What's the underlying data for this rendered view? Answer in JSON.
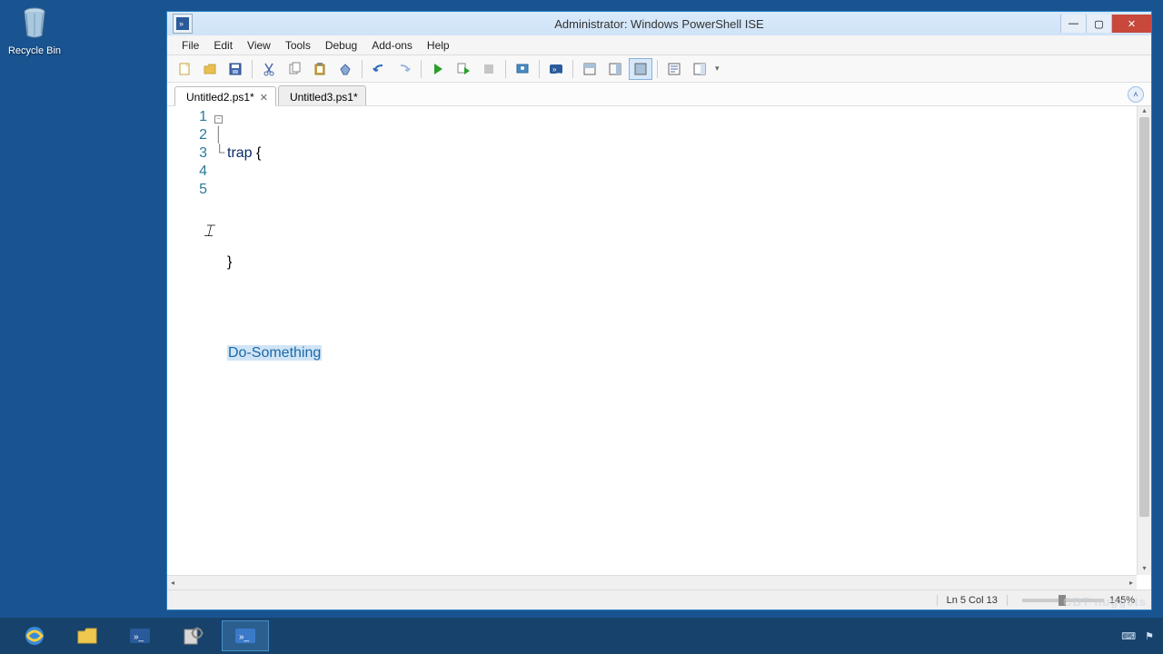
{
  "desktop": {
    "recycle_bin": "Recycle Bin"
  },
  "window": {
    "title": "Administrator: Windows PowerShell ISE",
    "controls": {
      "min": "—",
      "max": "▢",
      "close": "✕"
    }
  },
  "menu": {
    "file": "File",
    "edit": "Edit",
    "view": "View",
    "tools": "Tools",
    "debug": "Debug",
    "addons": "Add-ons",
    "help": "Help"
  },
  "toolbar": {
    "new": "new",
    "open": "open",
    "save": "save",
    "cut": "cut",
    "copy": "copy",
    "paste": "paste",
    "clear": "clear",
    "undo": "undo",
    "redo": "redo",
    "run": "run",
    "run_selection": "run-selection",
    "stop": "stop",
    "remote": "remote",
    "powershell": "powershell",
    "show_script_top": "layout-top",
    "show_script_right": "layout-right",
    "show_script_max": "layout-max",
    "show_command": "show-command",
    "show_addon": "show-addon"
  },
  "tabs": [
    {
      "label": "Untitled2.ps1*",
      "active": true
    },
    {
      "label": "Untitled3.ps1*",
      "active": false
    }
  ],
  "code": {
    "lines": [
      "1",
      "2",
      "3",
      "4",
      "5"
    ],
    "l1_kw": "trap",
    "l1_brace": " {",
    "l2": " ",
    "l3": "}",
    "l4": "",
    "l5_cmd": "Do-Something"
  },
  "status": {
    "position": "Ln 5  Col 13",
    "zoom": "145%"
  },
  "watermark": "CBT nuggets"
}
